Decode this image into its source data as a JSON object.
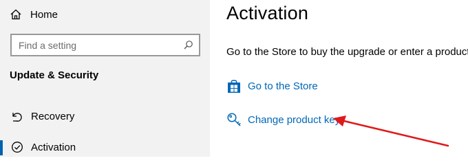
{
  "sidebar": {
    "home_label": "Home",
    "search": {
      "placeholder": "Find a setting"
    },
    "section_title": "Update & Security",
    "items": [
      {
        "label": "Recovery",
        "icon": "recovery-icon"
      },
      {
        "label": "Activation",
        "icon": "activation-icon",
        "selected": true
      }
    ]
  },
  "main": {
    "title": "Activation",
    "description": "Go to the Store to buy the upgrade or enter a product key.",
    "links": [
      {
        "label": "Go to the Store",
        "icon": "store-icon"
      },
      {
        "label": "Change product key",
        "icon": "key-icon"
      }
    ]
  },
  "colors": {
    "sidebar_bg": "#f2f2f2",
    "link": "#0067b8",
    "accent": "#0063b1",
    "annotation_arrow": "#e0191b"
  }
}
